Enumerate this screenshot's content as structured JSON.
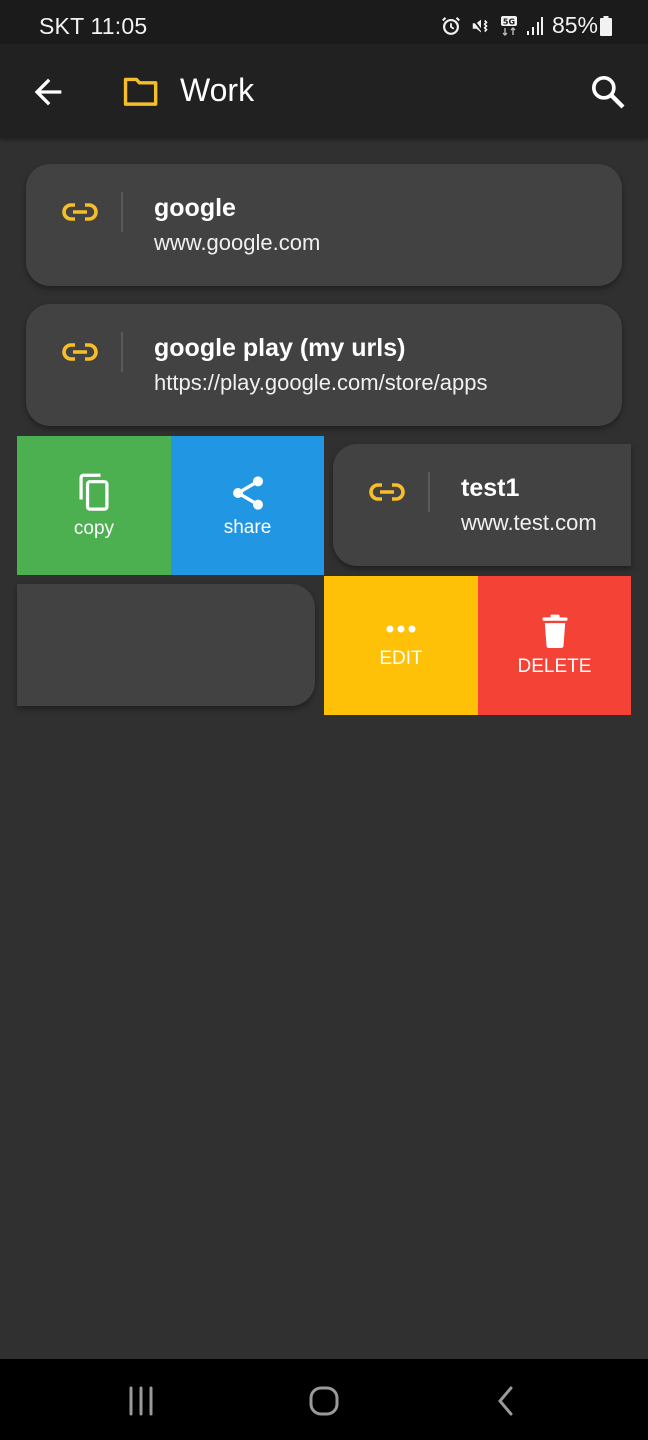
{
  "status_bar": {
    "carrier_time": "SKT 11:05",
    "icons": [
      "alarm-icon",
      "vibrate-mute-icon",
      "5g-icon",
      "signal-icon",
      "battery-icon"
    ],
    "battery_percent": "85%"
  },
  "app_bar": {
    "back_icon": "arrow-left-icon",
    "folder_icon": "folder-icon",
    "title": "Work",
    "search_icon": "search-icon"
  },
  "colors": {
    "accent_yellow": "#F6BE27",
    "copy_green": "#4CAF50",
    "share_blue": "#2196E3",
    "edit_amber": "#FFC107",
    "delete_red": "#F44336",
    "card_bg": "#424242",
    "page_bg": "#303030"
  },
  "links": [
    {
      "title": "google",
      "url": "www.google.com"
    },
    {
      "title": "google play (my urls)",
      "url": "https://play.google.com/store/apps"
    },
    {
      "title": "test1",
      "url": "www.test.com"
    },
    {
      "title": "",
      "url": ""
    }
  ],
  "swipe_actions": {
    "left": [
      {
        "label": "copy",
        "icon": "copy-icon"
      },
      {
        "label": "share",
        "icon": "share-icon"
      }
    ],
    "right": [
      {
        "label": "EDIT",
        "icon": "more-horizontal-icon"
      },
      {
        "label": "DELETE",
        "icon": "trash-icon"
      }
    ]
  },
  "nav_bar": {
    "recents": "recents-icon",
    "home": "home-icon",
    "back": "back-icon"
  }
}
